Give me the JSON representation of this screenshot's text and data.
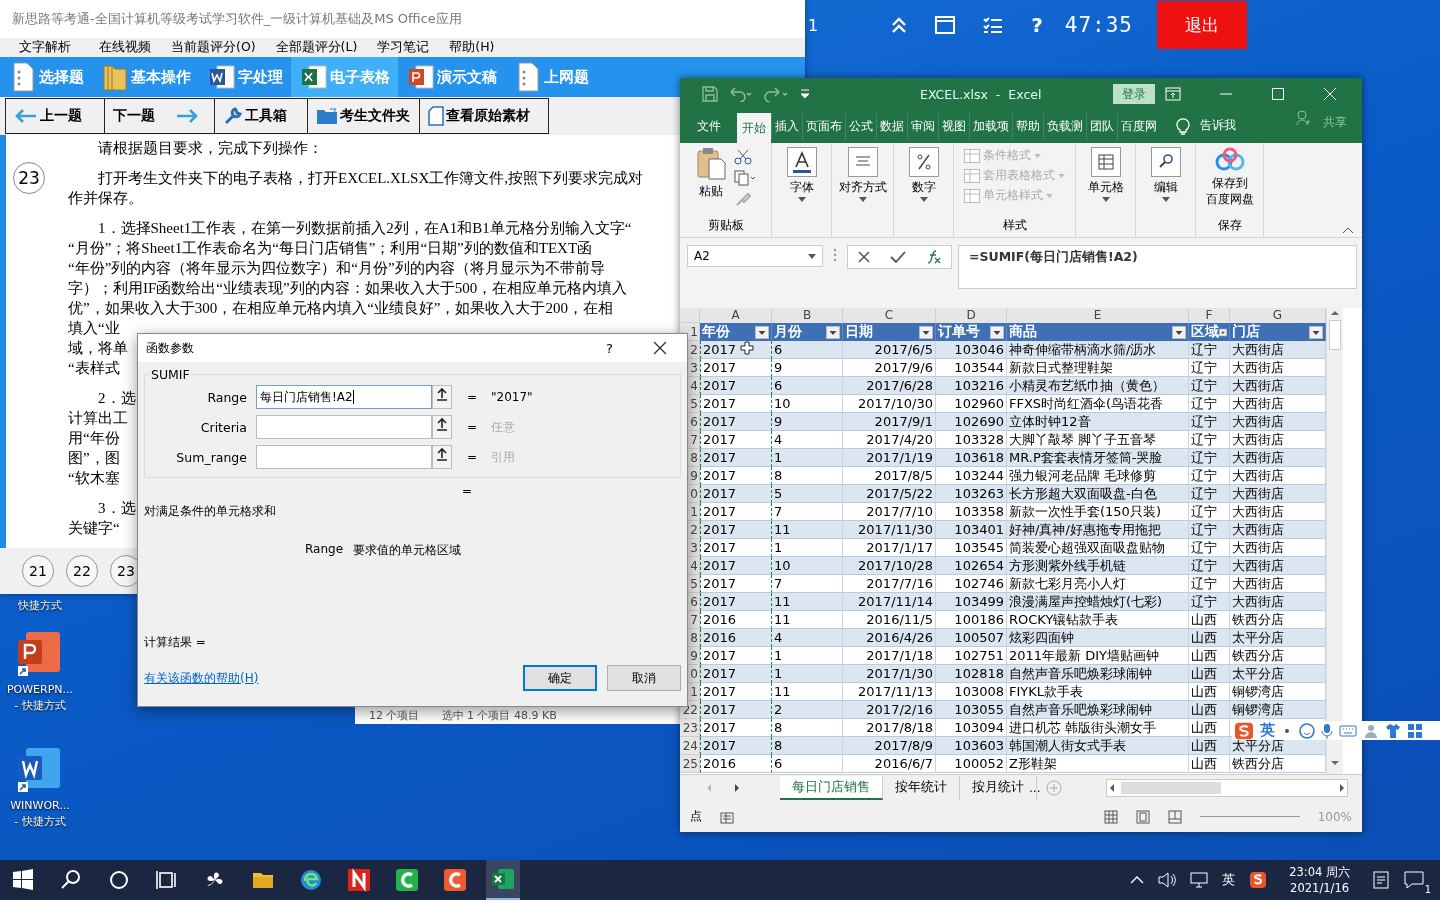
{
  "exam_window": {
    "title": "新思路等考通-全国计算机等级考试学习软件_一级计算机基础及MS Office应用",
    "menu": [
      "文字解析",
      "在线视频",
      "当前题评分(O)",
      "全部题评分(L)",
      "学习笔记",
      "帮助(H)"
    ],
    "modules": [
      {
        "label": "选择题",
        "kind": "doc",
        "selected": false
      },
      {
        "label": "基本操作",
        "kind": "folder",
        "selected": false
      },
      {
        "label": "字处理",
        "kind": "word",
        "selected": false
      },
      {
        "label": "电子表格",
        "kind": "excel",
        "selected": true
      },
      {
        "label": "演示文稿",
        "kind": "ppt",
        "selected": false
      },
      {
        "label": "上网题",
        "kind": "doc",
        "selected": false
      }
    ],
    "nav": [
      {
        "label": "上一题",
        "kind": "prev"
      },
      {
        "label": "下一题",
        "kind": "next"
      },
      {
        "label": "工具箱",
        "kind": "wrench"
      },
      {
        "label": "考生文件夹",
        "kind": "folder"
      },
      {
        "label": "查看原始素材",
        "kind": "page"
      }
    ],
    "question_number": "23",
    "paragraphs": [
      [
        "请根据题目要求，完成下列操作："
      ],
      [
        "打开考生文件夹下的电子表格，打开EXCEL.XLSX工作簿文件,按照下列要求完成对",
        "作并保存。"
      ],
      [
        "1．选择Sheet1工作表，在第一列数据前插入2列，在A1和B1单元格分别输入文字“",
        "“月份”；将Sheet1工作表命名为“每日门店销售”；利用“日期”列的数值和TEXT函",
        "“年份”列的内容（将年显示为四位数字）和“月份”列的内容（将月显示为不带前导",
        "字）；利用IF函数给出“业绩表现”列的内容：如果收入大于500，在相应单元格内填入",
        "优”，如果收入大于300，在相应单元格内填入“业绩良好”，如果收入大于200，在相",
        "填入“业",
        "域，将单",
        "“表样式"
      ],
      [
        "2．选",
        "计算出工",
        "用“年份",
        "图”，图",
        "“软木塞"
      ],
      [
        "3．选",
        "关键字“"
      ]
    ],
    "pages": [
      "21",
      "22",
      "23"
    ]
  },
  "exam_bar": {
    "question": "1",
    "help": "?",
    "timer": "47:35",
    "exit": "退出"
  },
  "desktop_icons": [
    {
      "kind": "partial",
      "labels": [
        "快捷方式"
      ]
    },
    {
      "kind": "ppt",
      "labels": [
        "POWERPN...",
        "- 快捷方式"
      ]
    },
    {
      "kind": "word",
      "labels": [
        "WINWOR...",
        "- 快捷方式"
      ]
    }
  ],
  "explorer_status": [
    "12 个项目",
    "选中 1 个项目  48.9 KB"
  ],
  "dialog": {
    "title": "函数参数",
    "help": "?",
    "function": "SUMIF",
    "args": [
      {
        "label": "Range",
        "value": "每日门店销售!A2",
        "sign": "=",
        "result": "\"2017\"",
        "filled": true
      },
      {
        "label": "Criteria",
        "sign": "=",
        "result": "任意",
        "filled": false
      },
      {
        "label": "Sum_range",
        "sign": "=",
        "result": "引用",
        "filled": false
      }
    ],
    "equals": "=",
    "description": "对满足条件的单元格求和",
    "arg_name": "Range",
    "arg_help": "要求值的单元格区域",
    "result_label": "计算结果 =",
    "help_link": "有关该函数的帮助(H)",
    "buttons": [
      {
        "label": "确定",
        "selected": true
      },
      {
        "label": "取消",
        "selected": false
      }
    ]
  },
  "excel": {
    "title": "EXCEL.xlsx  -  Excel",
    "sign_in": "登录",
    "tabs": [
      {
        "label": "文件",
        "selected": false
      },
      {
        "label": "开始",
        "selected": true
      },
      {
        "label": "插入",
        "selected": false
      },
      {
        "label": "页面布",
        "selected": false
      },
      {
        "label": "公式",
        "selected": false
      },
      {
        "label": "数据",
        "selected": false
      },
      {
        "label": "审阅",
        "selected": false
      },
      {
        "label": "视图",
        "selected": false
      },
      {
        "label": "加载项",
        "selected": false
      },
      {
        "label": "帮助",
        "selected": false
      },
      {
        "label": "负载测",
        "selected": false
      },
      {
        "label": "团队",
        "selected": false
      },
      {
        "label": "百度网",
        "selected": false
      }
    ],
    "tell_me": "告诉我",
    "share": "共享",
    "ribbon": {
      "paste": "粘贴",
      "clipboard": "剪贴板",
      "groups": [
        {
          "label": "字体",
          "kind": "font"
        },
        {
          "label": "对齐方式",
          "kind": "align"
        },
        {
          "label": "数字",
          "kind": "number"
        }
      ],
      "styles": [
        {
          "label": "条件格式",
          "disabled": true
        },
        {
          "label": "套用表格格式",
          "disabled": true
        },
        {
          "label": "单元格样式",
          "disabled": true
        }
      ],
      "styles_label": "样式",
      "groups2": [
        {
          "label": "单元格",
          "kind": "cells"
        },
        {
          "label": "编辑",
          "kind": "edit"
        }
      ],
      "save_lines": [
        "保存到",
        "百度网盘"
      ],
      "save_label": "保存"
    },
    "name_box": "A2",
    "formula": "=SUMIF(每日门店销售!A2)",
    "columns": [
      "A",
      "B",
      "C",
      "D",
      "E",
      "F",
      "G"
    ],
    "header_row": "1",
    "headers": [
      "年份",
      "月份",
      "日期",
      "订单号",
      "商品",
      "区域",
      "门店"
    ],
    "rows": [
      {
        "n": "2",
        "cells": [
          "2017",
          "6",
          "2017/6/5",
          "103046",
          "神奇伸缩带柄滴水筛/沥水",
          "辽宁",
          "大西街店"
        ]
      },
      {
        "n": "3",
        "cells": [
          "2017",
          "9",
          "2017/9/6",
          "103544",
          "新款日式整理鞋架",
          "辽宁",
          "大西街店"
        ]
      },
      {
        "n": "4",
        "cells": [
          "2017",
          "6",
          "2017/6/28",
          "103216",
          "小精灵布艺纸巾抽（黄色）",
          "辽宁",
          "大西街店"
        ]
      },
      {
        "n": "5",
        "cells": [
          "2017",
          "10",
          "2017/10/30",
          "102960",
          "FFXS时尚红酒伞(鸟语花香",
          "辽宁",
          "大西街店"
        ]
      },
      {
        "n": "6",
        "cells": [
          "2017",
          "9",
          "2017/9/1",
          "102690",
          "立体时钟12音",
          "辽宁",
          "大西街店"
        ]
      },
      {
        "n": "7",
        "cells": [
          "2017",
          "4",
          "2017/4/20",
          "103328",
          "大脚丫敲琴 脚丫子五音琴",
          "辽宁",
          "大西街店"
        ]
      },
      {
        "n": "8",
        "cells": [
          "2017",
          "1",
          "2017/1/19",
          "103618",
          "MR.P套套表情牙签筒-哭脸",
          "辽宁",
          "大西街店"
        ]
      },
      {
        "n": "9",
        "cells": [
          "2017",
          "8",
          "2017/8/5",
          "103244",
          "强力银河老品牌 毛球修剪",
          "辽宁",
          "大西街店"
        ]
      },
      {
        "n": "0",
        "cells": [
          "2017",
          "5",
          "2017/5/22",
          "103263",
          "长方形超大双面吸盘-白色",
          "辽宁",
          "大西街店"
        ]
      },
      {
        "n": "1",
        "cells": [
          "2017",
          "7",
          "2017/7/10",
          "103358",
          "新款一次性手套(150只装)",
          "辽宁",
          "大西街店"
        ]
      },
      {
        "n": "2",
        "cells": [
          "2017",
          "11",
          "2017/11/30",
          "103401",
          "好神/真神/好惠拖专用拖把",
          "辽宁",
          "大西街店"
        ]
      },
      {
        "n": "3",
        "cells": [
          "2017",
          "1",
          "2017/1/17",
          "103545",
          "简装爱心超强双面吸盘贴物",
          "辽宁",
          "大西街店"
        ]
      },
      {
        "n": "4",
        "cells": [
          "2017",
          "10",
          "2017/10/28",
          "102654",
          "方形测紫外线手机链",
          "辽宁",
          "大西街店"
        ]
      },
      {
        "n": "5",
        "cells": [
          "2017",
          "7",
          "2017/7/16",
          "102746",
          "新款七彩月亮小人灯",
          "辽宁",
          "大西街店"
        ]
      },
      {
        "n": "6",
        "cells": [
          "2017",
          "11",
          "2017/11/14",
          "103499",
          "浪漫满屋声控蜡烛灯(七彩)",
          "辽宁",
          "大西街店"
        ]
      },
      {
        "n": "7",
        "cells": [
          "2016",
          "11",
          "2016/11/5",
          "100186",
          "ROCKY镶钻款手表",
          "山西",
          "铁西分店"
        ]
      },
      {
        "n": "8",
        "cells": [
          "2016",
          "4",
          "2016/4/26",
          "100507",
          "炫彩四面钟",
          "山西",
          "太平分店"
        ]
      },
      {
        "n": "9",
        "cells": [
          "2017",
          "1",
          "2017/1/18",
          "102751",
          "2011年最新 DIY墙贴画钟",
          "山西",
          "铁西分店"
        ]
      },
      {
        "n": "0",
        "cells": [
          "2017",
          "1",
          "2017/1/30",
          "102818",
          "自然声音乐吧焕彩球闹钟",
          "山西",
          "太平分店"
        ]
      },
      {
        "n": "1",
        "cells": [
          "2017",
          "11",
          "2017/11/13",
          "103008",
          "FIYKL款手表",
          "山西",
          "铜锣湾店"
        ]
      },
      {
        "n": "22",
        "cells": [
          "2017",
          "2",
          "2017/2/16",
          "103055",
          "自然声音乐吧焕彩球闹钟",
          "山西",
          "铜锣湾店"
        ]
      },
      {
        "n": "23",
        "cells": [
          "2017",
          "8",
          "2017/8/18",
          "103094",
          "进口机芯 韩版街头潮女手",
          "山西"
        ]
      },
      {
        "n": "24",
        "cells": [
          "2017",
          "8",
          "2017/8/9",
          "103603",
          "韩国潮人街女式手表",
          "山西",
          "太平分店"
        ]
      },
      {
        "n": "25",
        "cells": [
          "2016",
          "6",
          "2016/6/7",
          "100052",
          "Z形鞋架",
          "山西",
          "铁西分店"
        ]
      }
    ],
    "sheets": [
      {
        "label": "每日门店销售",
        "selected": true
      },
      {
        "label": "按年统计",
        "selected": false
      },
      {
        "label": "按月统计",
        "selected": false
      }
    ],
    "more_sheets": "...",
    "status": "点",
    "zoom": "100%"
  },
  "ime": {
    "mode": "英"
  },
  "taskbar": {
    "apps": [
      {
        "kind": "start",
        "selected": false
      },
      {
        "kind": "search",
        "selected": false
      },
      {
        "kind": "cortana",
        "selected": false
      },
      {
        "kind": "taskview",
        "selected": false
      },
      {
        "kind": "pinwheel",
        "selected": false
      },
      {
        "kind": "explorer",
        "selected": false
      },
      {
        "kind": "edge",
        "selected": false
      },
      {
        "kind": "napp",
        "selected": false
      },
      {
        "kind": "cgreen",
        "selected": false
      },
      {
        "kind": "corange",
        "selected": false
      },
      {
        "kind": "excel",
        "selected": true
      }
    ],
    "input": "英",
    "time": "23:04 周六",
    "date": "2021/1/16",
    "notifications": "1"
  }
}
